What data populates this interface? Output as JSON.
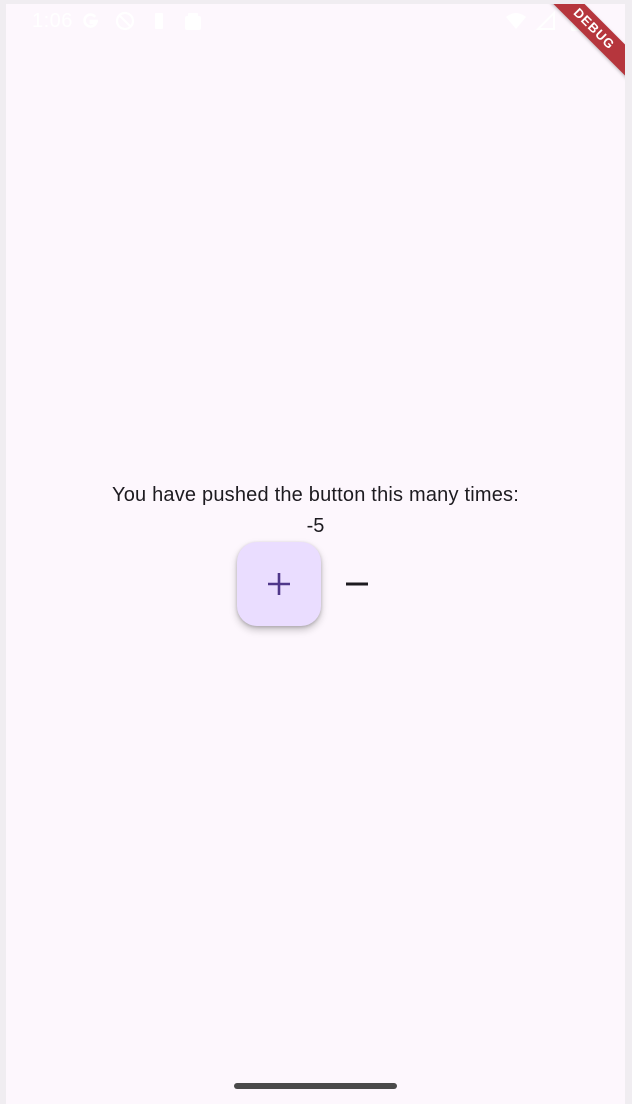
{
  "status_bar": {
    "time": "1:06",
    "left_icons": [
      "google-icon",
      "dnd-icon",
      "sim-icon",
      "android-icon"
    ],
    "right_icons": [
      "wifi-icon",
      "signal-icon",
      "battery-icon"
    ]
  },
  "debug_banner": {
    "label": "DEBUG",
    "color": "#b6363d"
  },
  "main": {
    "message": "You have pushed the button this many times:",
    "counter": "-5"
  },
  "actions": {
    "increment_icon": "plus-icon",
    "decrement_icon": "minus-icon"
  },
  "colors": {
    "background": "#fdf7fd",
    "fab_background": "#eaddff",
    "fab_icon": "#4f378a",
    "text": "#1d1b20"
  }
}
